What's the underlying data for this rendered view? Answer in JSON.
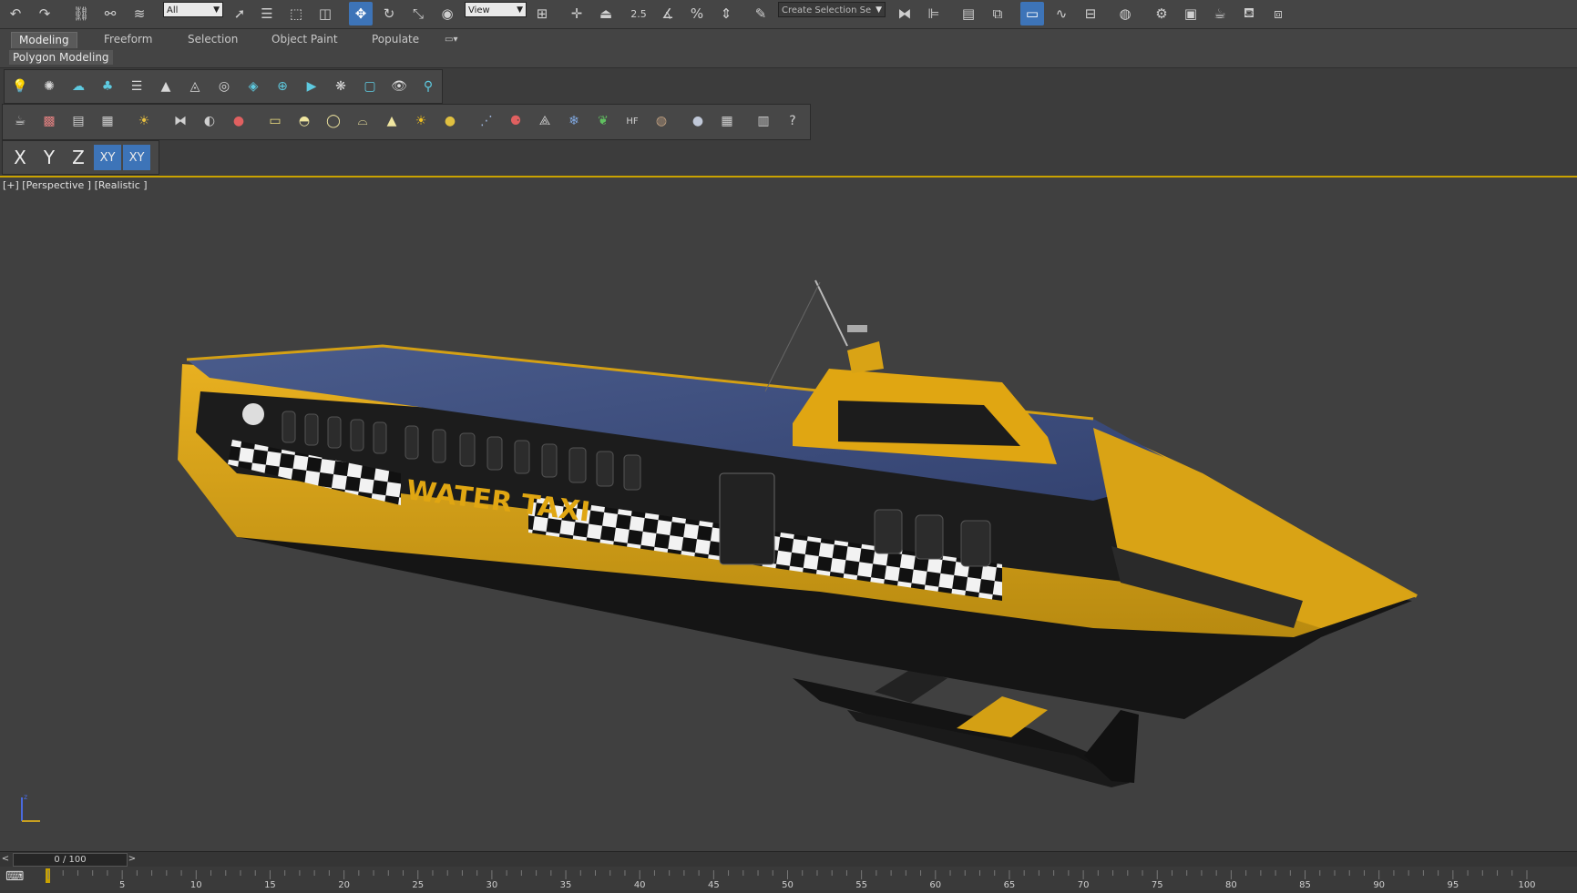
{
  "main_toolbar": {
    "selection_filter": "All",
    "reference_coord": "View",
    "snap_angle_label": "2.5",
    "named_selection_placeholder": "Create Selection Se"
  },
  "ribbon": {
    "tabs": [
      "Modeling",
      "Freeform",
      "Selection",
      "Object Paint",
      "Populate"
    ],
    "active_tab": "Modeling",
    "panel_label": "Polygon Modeling"
  },
  "axis_constraints": {
    "x": "X",
    "y": "Y",
    "z": "Z",
    "xy": "XY",
    "xy_snap": "XY"
  },
  "viewport": {
    "label": "[+] [Perspective ] [Realistic ]",
    "boat_text": "WATER TAXI",
    "colors": {
      "hull_yellow": "#e0a612",
      "hull_dark": "#1a1a1a",
      "deck_blue": "#3d4f7a",
      "background": "#404040"
    }
  },
  "time_slider": {
    "frame_display": "0 / 100",
    "prev_arrow": "<",
    "next_arrow": ">"
  },
  "timeline": {
    "ticks": [
      "5",
      "10",
      "15",
      "20",
      "25",
      "30",
      "35",
      "40",
      "45",
      "50",
      "55",
      "60",
      "65",
      "70",
      "75",
      "80",
      "85",
      "90",
      "95",
      "100"
    ]
  }
}
